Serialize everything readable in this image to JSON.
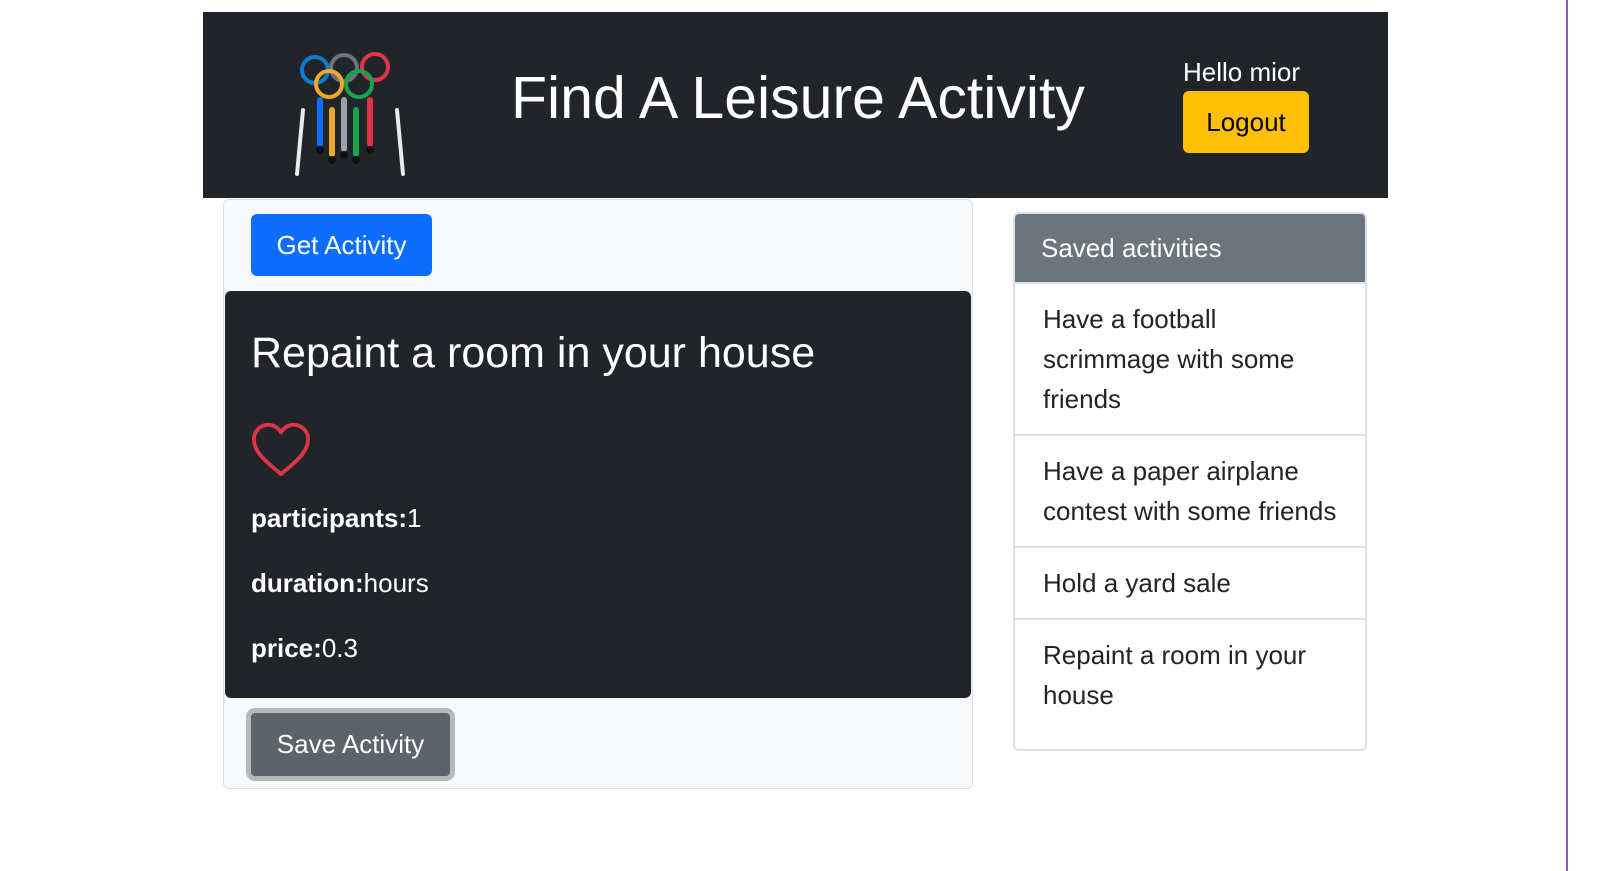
{
  "header": {
    "title": "Find A Leisure Activity",
    "greeting": "Hello mior",
    "logout_label": "Logout",
    "logo_icon": "olympic-rings-jump-ropes-icon"
  },
  "main": {
    "get_activity_label": "Get Activity",
    "activity": {
      "title": "Repaint a room in your house",
      "favorite_icon": "heart-outline-icon",
      "participants_label": "participants:",
      "participants_value": "1",
      "duration_label": "duration:",
      "duration_value": "hours",
      "price_label": "price:",
      "price_value": "0.3"
    },
    "save_activity_label": "Save Activity"
  },
  "saved": {
    "header": "Saved activities",
    "items": [
      "Have a football scrimmage with some friends",
      "Have a paper airplane contest with some friends",
      "Hold a yard sale",
      "Repaint a room in your house"
    ]
  },
  "colors": {
    "header_bg": "#212529",
    "primary": "#0d6efd",
    "warning": "#ffc107",
    "secondary": "#6c757d",
    "heart": "#dc3545"
  }
}
